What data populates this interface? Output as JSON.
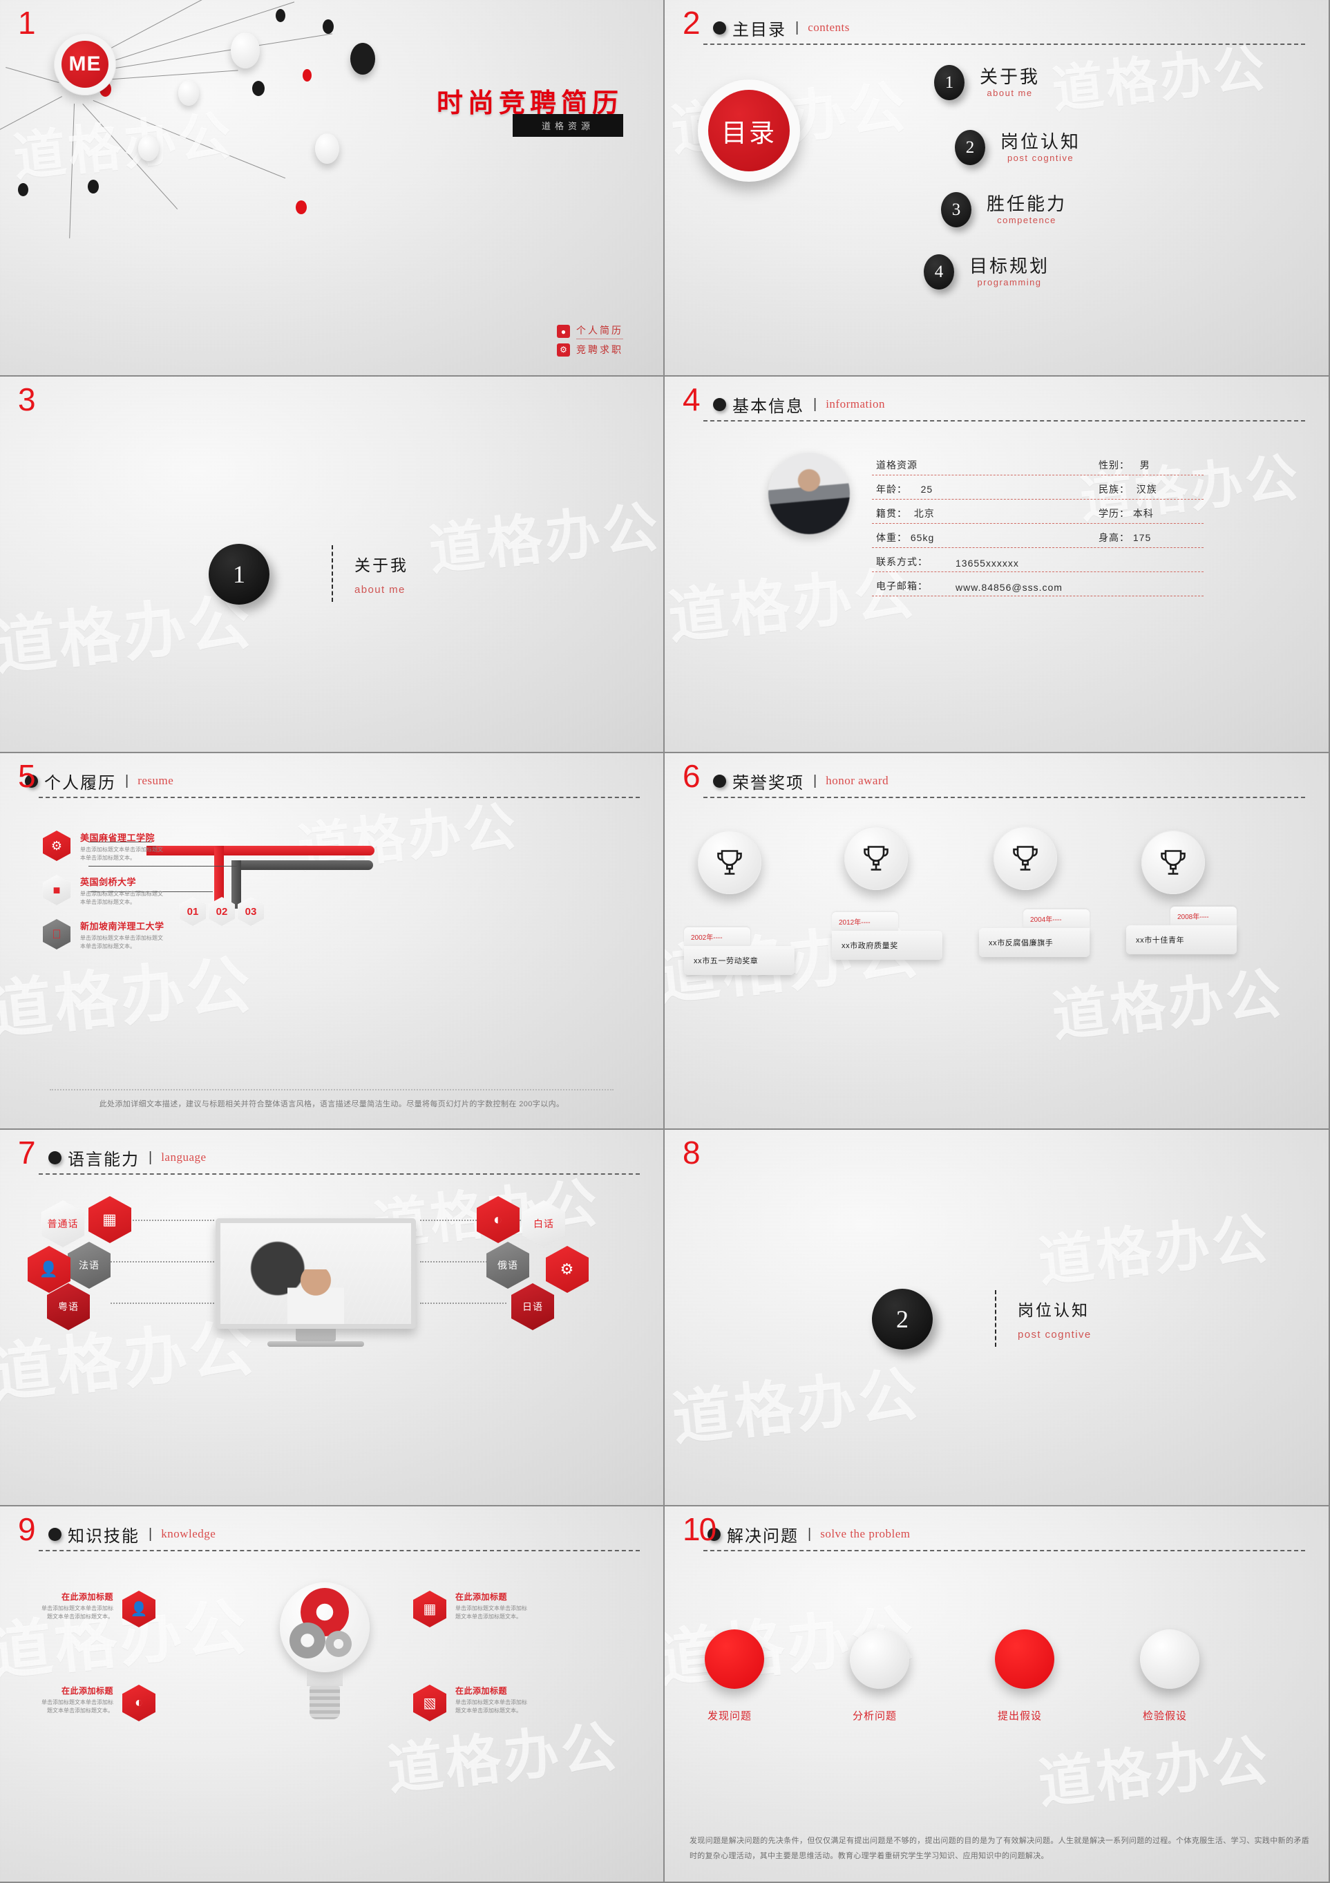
{
  "slides": [
    {
      "num": "1",
      "title": "时尚竞聘简历",
      "subtitle": "道格资源",
      "logo_text": "ME",
      "badges": [
        {
          "icon": "user-icon",
          "label": "个人简历"
        },
        {
          "icon": "gear-icon",
          "label": "竞聘求职"
        }
      ]
    },
    {
      "num": "2",
      "header_zh": "主目录",
      "header_en": "contents",
      "center_label": "目录",
      "items": [
        {
          "num": "1",
          "zh": "关于我",
          "en": "about me"
        },
        {
          "num": "2",
          "zh": "岗位认知",
          "en": "post cogntive"
        },
        {
          "num": "3",
          "zh": "胜任能力",
          "en": "competence"
        },
        {
          "num": "4",
          "zh": "目标规划",
          "en": "programming"
        }
      ]
    },
    {
      "num": "3",
      "circle_num": "1",
      "zh": "关于我",
      "en": "about me"
    },
    {
      "num": "4",
      "header_zh": "基本信息",
      "header_en": "information",
      "rows": [
        {
          "left_label": "道格资源",
          "left_value": "",
          "right_label": "性别：",
          "right_value": "男"
        },
        {
          "left_label": "年龄：",
          "left_value": "25",
          "right_label": "民族：",
          "right_value": "汉族"
        },
        {
          "left_label": "籍贯：",
          "left_value": "北京",
          "right_label": "学历：",
          "right_value": "本科"
        },
        {
          "left_label": "体重：",
          "left_value": "65kg",
          "right_label": "身高：",
          "right_value": "175"
        }
      ],
      "full_rows": [
        {
          "label": "联系方式：",
          "value": "13655xxxxxx"
        },
        {
          "label": "电子邮箱：",
          "value": "www.84856@sss.com"
        }
      ]
    },
    {
      "num": "5",
      "header_zh": "个人履历",
      "header_en": "resume",
      "schools": [
        {
          "icon": "android-icon",
          "name": "美国麻省理工学院",
          "desc": "单击添加标题文本单击添加标题文本单击添加标题文本。"
        },
        {
          "icon": "windows-icon",
          "name": "英国剑桥大学",
          "desc": "单击添加标题文本单击添加标题文本单击添加标题文本。"
        },
        {
          "icon": "apple-icon",
          "name": "新加坡南洋理工大学",
          "desc": "单击添加标题文本单击添加标题文本单击添加标题文本。"
        }
      ],
      "badges": [
        "01",
        "02",
        "03"
      ],
      "note": "此处添加详细文本描述，建议与标题相关并符合整体语言风格，语言描述尽量简洁生动。尽量将每页幻灯片的字数控制在 200字以内。"
    },
    {
      "num": "6",
      "header_zh": "荣誉奖项",
      "header_en": "honor award",
      "awards": [
        {
          "year": "2002年----",
          "name": "xx市五一劳动奖章"
        },
        {
          "year": "2012年----",
          "name": "xx市政府质量奖"
        },
        {
          "year": "2004年----",
          "name": "xx市反腐倡廉旗手"
        },
        {
          "year": "2008年----",
          "name": "xx市十佳青年"
        }
      ]
    },
    {
      "num": "7",
      "header_zh": "语言能力",
      "header_en": "language",
      "left_langs": [
        {
          "label": "普通话",
          "style": "white"
        },
        {
          "label": "法语",
          "style": "gray"
        },
        {
          "label": "粤语",
          "style": "dred"
        }
      ],
      "right_langs": [
        {
          "label": "白话",
          "style": "white"
        },
        {
          "label": "俄语",
          "style": "gray"
        },
        {
          "label": "日语",
          "style": "dred"
        }
      ],
      "left_icons": [
        "chart-bar-icon",
        "user-group-icon"
      ],
      "right_icons": [
        "pie-chart-icon",
        "gear-icon"
      ]
    },
    {
      "num": "8",
      "circle_num": "2",
      "zh": "岗位认知",
      "en": "post cogntive"
    },
    {
      "num": "9",
      "header_zh": "知识技能",
      "header_en": "knowledge",
      "items": [
        {
          "title": "在此添加标题",
          "desc": "单击添加标题文本单击添加标题文本单击添加标题文本。",
          "icon": "user-tie-icon",
          "side": "left"
        },
        {
          "title": "在此添加标题",
          "desc": "单击添加标题文本单击添加标题文本单击添加标题文本。",
          "icon": "chart-bar-icon",
          "side": "right"
        },
        {
          "title": "在此添加标题",
          "desc": "单击添加标题文本单击添加标题文本单击添加标题文本。",
          "icon": "pie-chart-icon",
          "side": "left"
        },
        {
          "title": "在此添加标题",
          "desc": "单击添加标题文本单击添加标题文本单击添加标题文本。",
          "icon": "bar-graph-icon",
          "side": "right"
        }
      ]
    },
    {
      "num": "10",
      "header_zh": "解决问题",
      "header_en": "solve the problem",
      "steps": [
        {
          "label": "发现问题",
          "style": "red"
        },
        {
          "label": "分析问题",
          "style": "white"
        },
        {
          "label": "提出假设",
          "style": "red"
        },
        {
          "label": "检验假设",
          "style": "white"
        }
      ],
      "paragraph": "发现问题是解决问题的先决条件，但仅仅满足有提出问题是不够的，提出问题的目的是为了有效解决问题。人生就是解决一系列问题的过程。个体克服生活、学习、实践中新的矛盾时的复杂心理活动，其中主要是思维活动。教育心理学着重研究学生学习知识、应用知识中的问题解决。"
    }
  ],
  "watermark": "道格办公",
  "colors": {
    "accent_red": "#e2232a",
    "dark": "#141414",
    "muted": "#8b8b8b"
  }
}
